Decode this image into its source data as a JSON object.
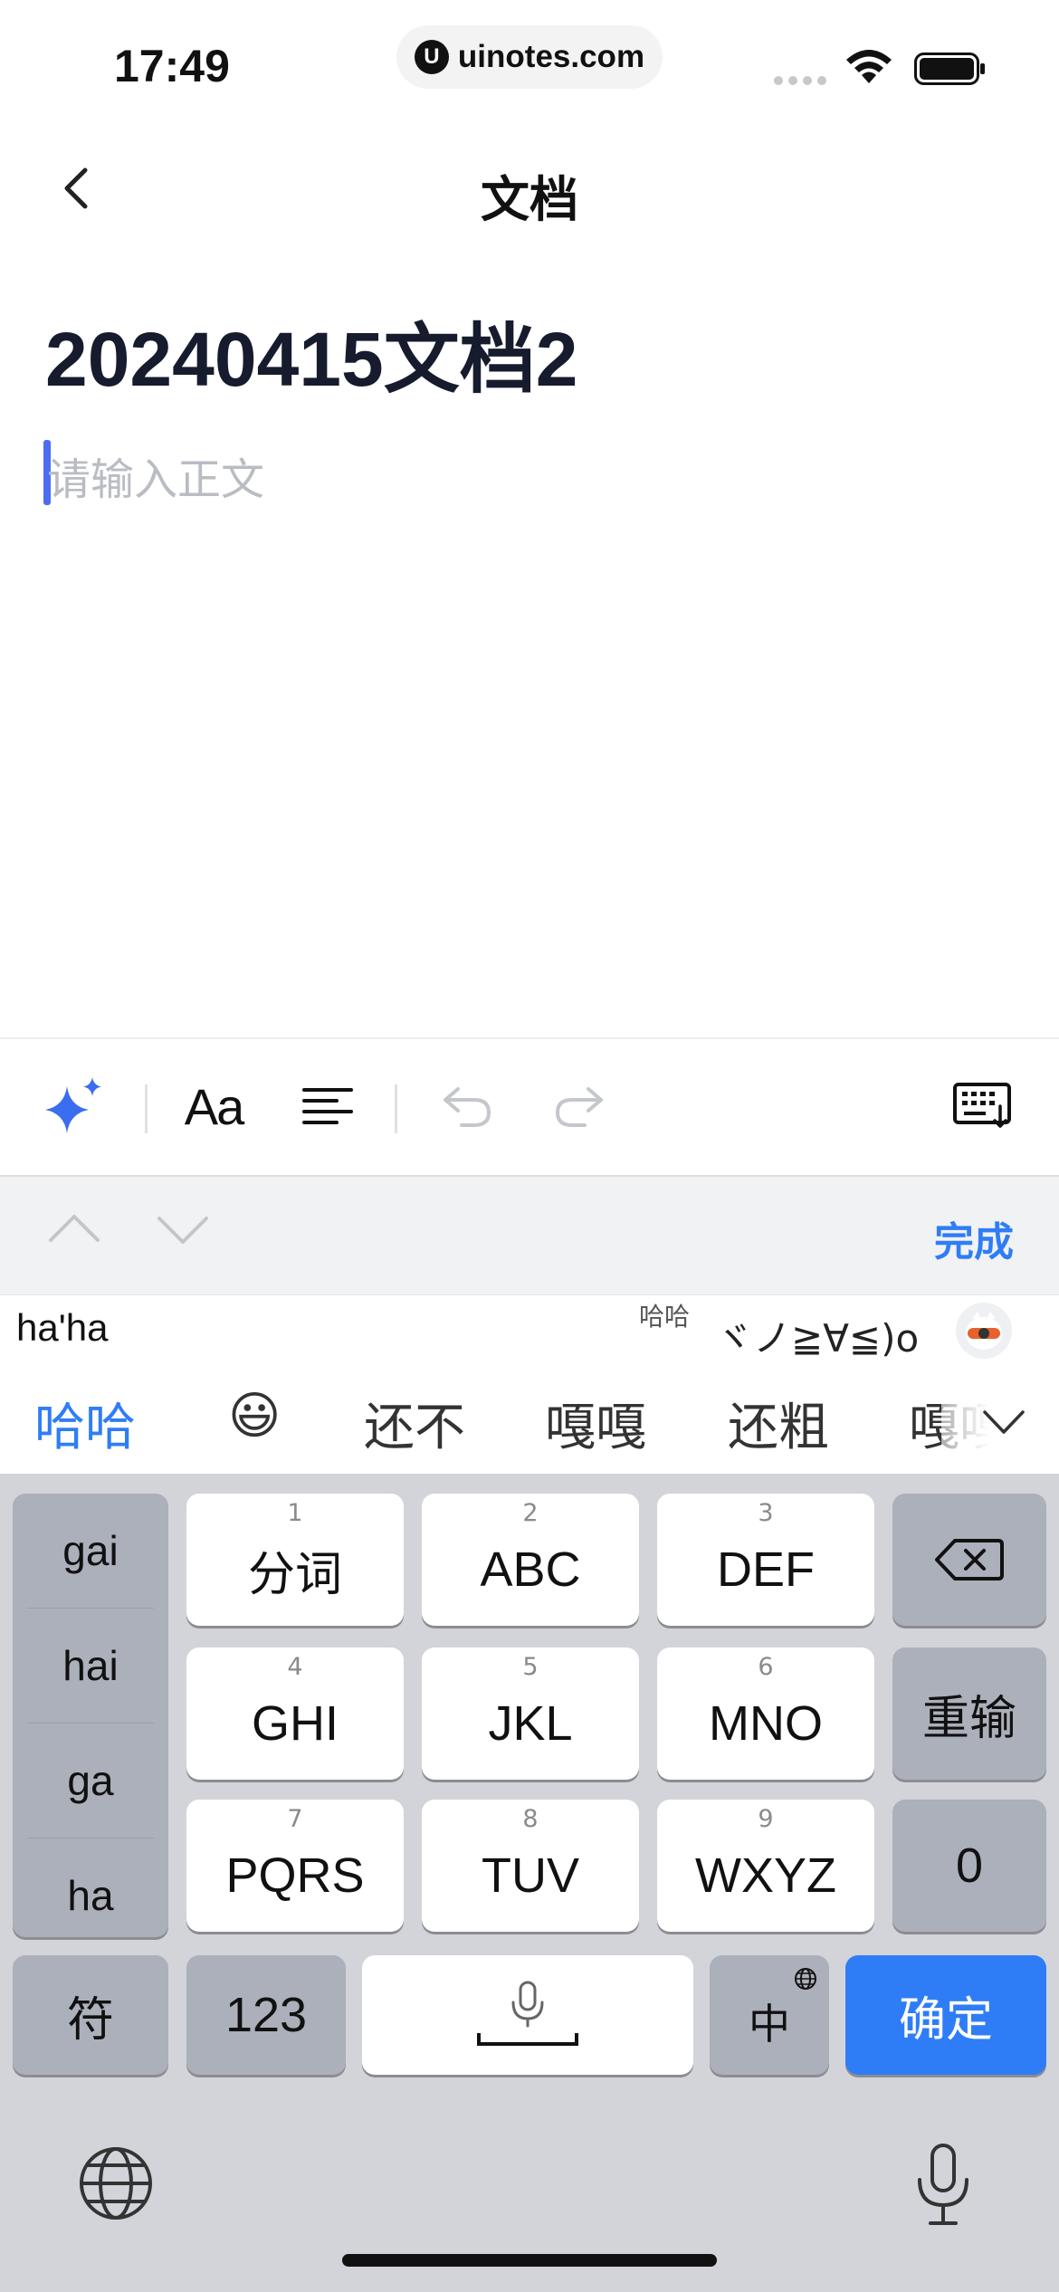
{
  "status": {
    "time": "17:49",
    "url": "uinotes.com",
    "url_logo": "U"
  },
  "nav": {
    "title": "文档"
  },
  "doc": {
    "title": "20240415文档2",
    "body_placeholder": "请输入正文"
  },
  "toolbar": {
    "format_label": "Aa"
  },
  "accessory": {
    "done_label": "完成"
  },
  "ime": {
    "pinyin": "ha'ha",
    "emoticon_hint": "哈哈",
    "kaomoji": "ヾノ≧∀≦)o",
    "candidates": [
      "哈哈",
      "😃",
      "还不",
      "嘎嘎",
      "还粗",
      "嘎嘎"
    ]
  },
  "keyboard": {
    "syllables": [
      "gai",
      "hai",
      "ga",
      "ha"
    ],
    "keys": [
      {
        "num": "1",
        "label": "分词"
      },
      {
        "num": "2",
        "label": "ABC"
      },
      {
        "num": "3",
        "label": "DEF"
      },
      {
        "num": "4",
        "label": "GHI"
      },
      {
        "num": "5",
        "label": "JKL"
      },
      {
        "num": "6",
        "label": "MNO"
      },
      {
        "num": "7",
        "label": "PQRS"
      },
      {
        "num": "8",
        "label": "TUV"
      },
      {
        "num": "9",
        "label": "WXYZ"
      }
    ],
    "reinput_label": "重输",
    "zero_label": "0",
    "symbol_label": "符",
    "numeric_label": "123",
    "lang_label": "中",
    "confirm_label": "确定"
  },
  "colors": {
    "accent": "#2f7df6",
    "caret": "#4d6cf2",
    "keyboard_bg": "#d2d4da",
    "gray_key": "#abb0ba"
  }
}
